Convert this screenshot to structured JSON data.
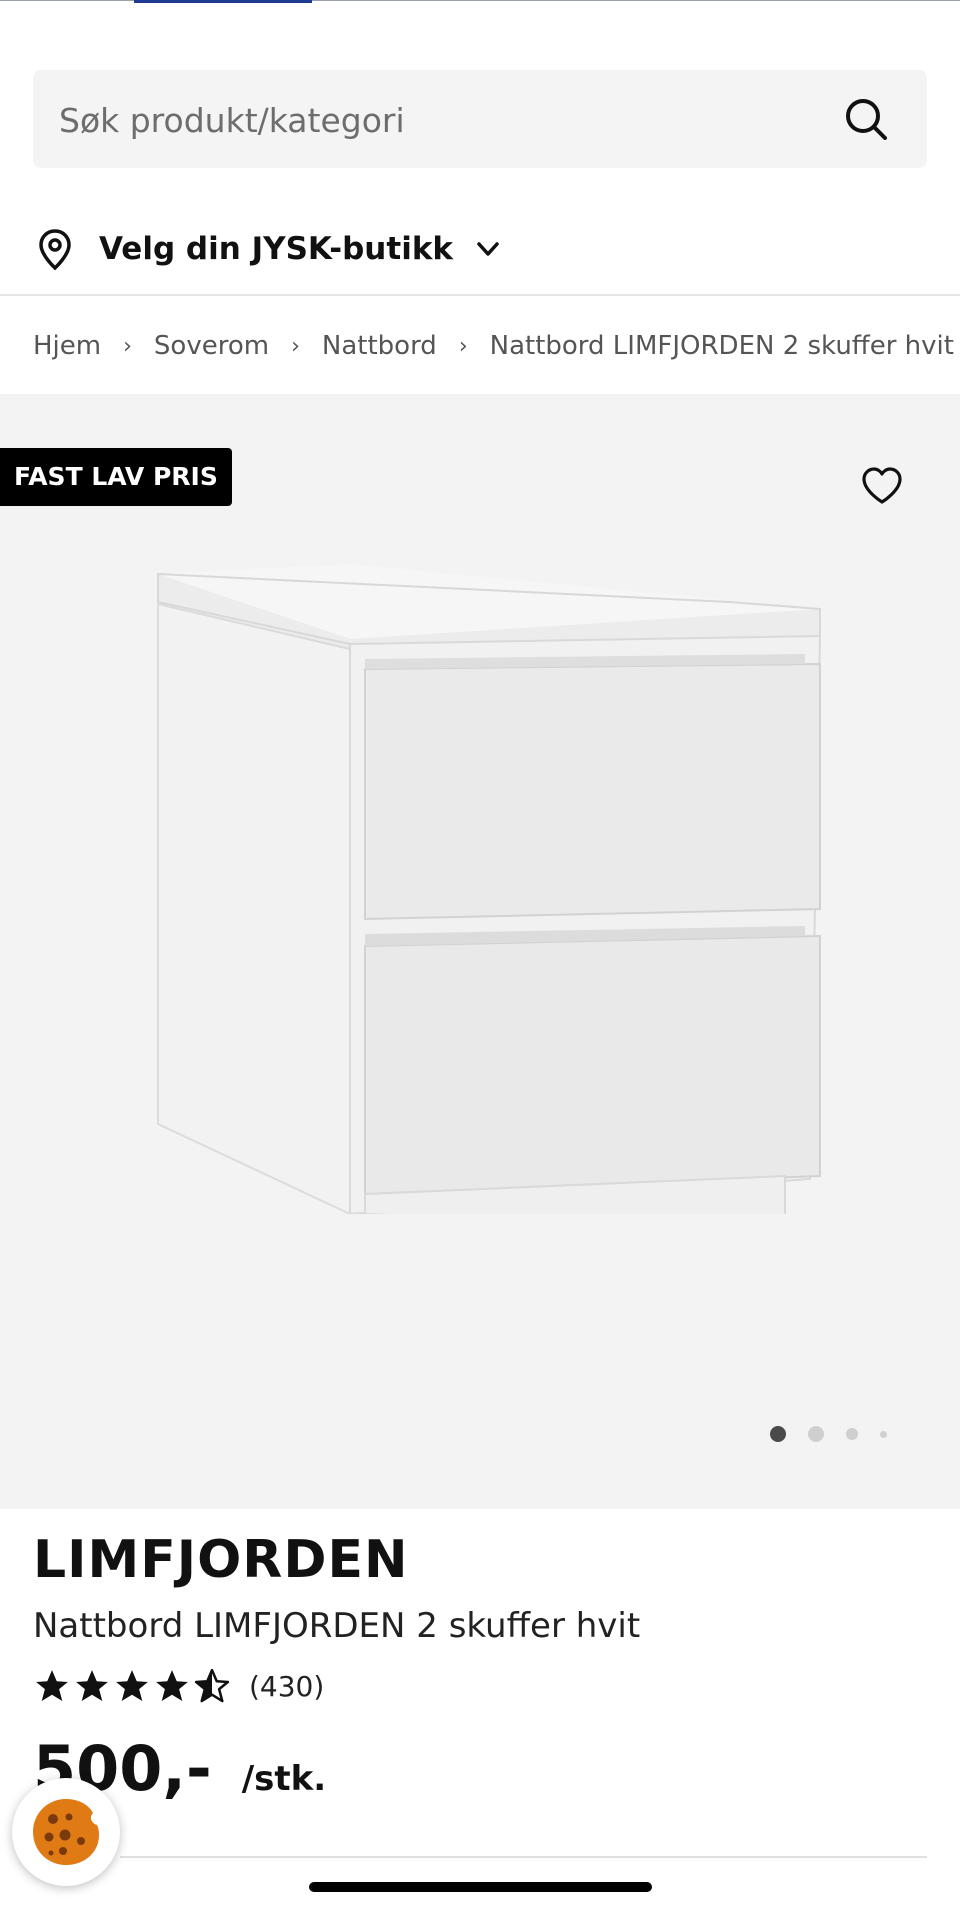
{
  "search": {
    "placeholder": "Søk produkt/kategori",
    "icon": "search-icon"
  },
  "store": {
    "label": "Velg din JYSK-butikk",
    "icon": "location-pin-icon",
    "chevron": "chevron-down-icon"
  },
  "breadcrumb": {
    "items": [
      "Hjem",
      "Soverom",
      "Nattbord",
      "Nattbord LIMFJORDEN 2 skuffer hvit"
    ],
    "separator": "›"
  },
  "gallery": {
    "badge": "FAST LAV PRIS",
    "favorite_icon": "heart-outline-icon",
    "image_alt": "Nattbord LIMFJORDEN 2 skuffer hvit",
    "slide_count": 4,
    "active_slide": 1
  },
  "product": {
    "brand": "LIMFJORDEN",
    "title": "Nattbord LIMFJORDEN 2 skuffer hvit",
    "rating": {
      "stars": 4.5,
      "max": 5,
      "count": "(430)"
    },
    "price": "500,-",
    "unit": "/stk."
  },
  "cookie_button": {
    "icon": "cookie-icon"
  },
  "colors": {
    "accent": "#1f3a93",
    "badge_bg": "#000000",
    "gallery_bg": "#f3f3f3",
    "cookie": "#e07a14"
  }
}
